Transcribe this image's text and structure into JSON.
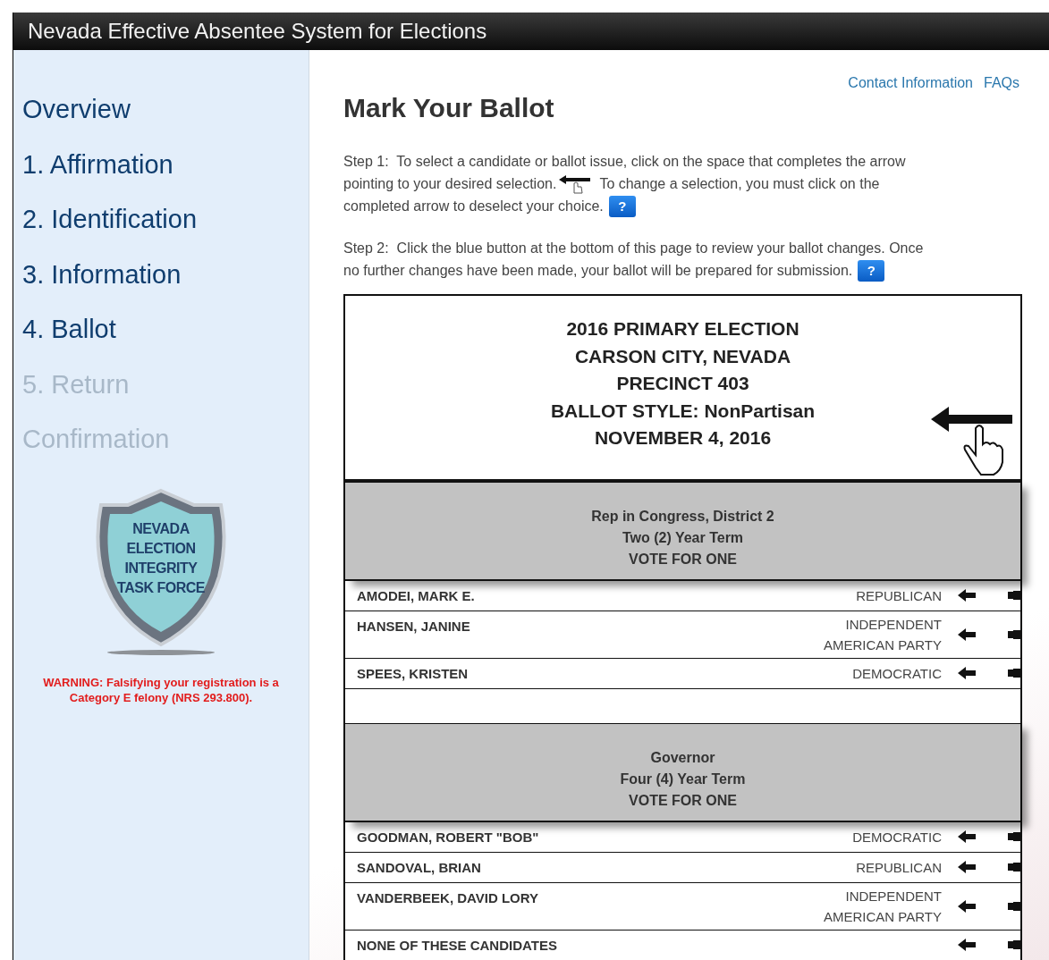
{
  "app_title": "Nevada Effective Absentee System for Elections",
  "sidebar": {
    "items": [
      {
        "label": "Overview",
        "disabled": false
      },
      {
        "label": "1. Affirmation",
        "disabled": false
      },
      {
        "label": "2. Identification",
        "disabled": false
      },
      {
        "label": "3. Information",
        "disabled": false
      },
      {
        "label": "4. Ballot",
        "disabled": false
      },
      {
        "label": "5. Return",
        "disabled": true
      },
      {
        "label": "Confirmation",
        "disabled": true
      }
    ],
    "badge_lines": [
      "NEVADA",
      "ELECTION",
      "INTEGRITY",
      "TASK FORCE"
    ],
    "warning": "WARNING: Falsifying your registration is a Category E felony (NRS 293.800)."
  },
  "top_links": [
    "Contact Information",
    "FAQs"
  ],
  "heading": "Mark Your Ballot",
  "steps": [
    {
      "lines": [
        [
          {
            "kind": "text",
            "text": "Step 1:  To select a candidate or ballot issue, click on the space that completes the arrow"
          }
        ],
        [
          {
            "kind": "text",
            "text": "pointing to your desired selection."
          },
          {
            "kind": "arrow"
          },
          {
            "kind": "text",
            "text": "To change a selection, you must click on the"
          }
        ],
        [
          {
            "kind": "text",
            "text": "completed arrow to deselect your choice."
          },
          {
            "kind": "help",
            "text": "?"
          }
        ]
      ]
    },
    {
      "lines": [
        [
          {
            "kind": "text",
            "text": "Step 2:  Click the blue button at the bottom of this page to review your ballot changes. Once"
          }
        ],
        [
          {
            "kind": "text",
            "text": "no further changes have been made, your ballot will be prepared for submission."
          },
          {
            "kind": "help",
            "text": "?"
          }
        ]
      ]
    }
  ],
  "ballot": {
    "header_lines": [
      "2016 PRIMARY ELECTION",
      "CARSON CITY, NEVADA",
      "PRECINCT 403",
      "BALLOT STYLE: NonPartisan",
      "NOVEMBER 4, 2016"
    ],
    "contests": [
      {
        "title_lines": [
          "Rep in Congress, District 2",
          "Two (2) Year Term",
          "VOTE FOR ONE"
        ],
        "candidates": [
          {
            "name": "AMODEI, MARK E.",
            "party": [
              "REPUBLICAN"
            ],
            "selected": false
          },
          {
            "name": "HANSEN, JANINE",
            "party": [
              "INDEPENDENT",
              "AMERICAN PARTY"
            ],
            "selected": false
          },
          {
            "name": "SPEES, KRISTEN",
            "party": [
              "DEMOCRATIC"
            ],
            "selected": false
          }
        ]
      },
      {
        "title_lines": [
          "Governor",
          "Four (4) Year Term",
          "VOTE FOR ONE"
        ],
        "candidates": [
          {
            "name": "GOODMAN, ROBERT \"BOB\"",
            "party": [
              "DEMOCRATIC"
            ],
            "selected": false
          },
          {
            "name": "SANDOVAL, BRIAN",
            "party": [
              "REPUBLICAN"
            ],
            "selected": false
          },
          {
            "name": "VANDERBEEK, DAVID LORY",
            "party": [
              "INDEPENDENT",
              "AMERICAN PARTY"
            ],
            "selected": false
          },
          {
            "name": "NONE OF THESE CANDIDATES",
            "selected": false
          }
        ]
      }
    ]
  }
}
